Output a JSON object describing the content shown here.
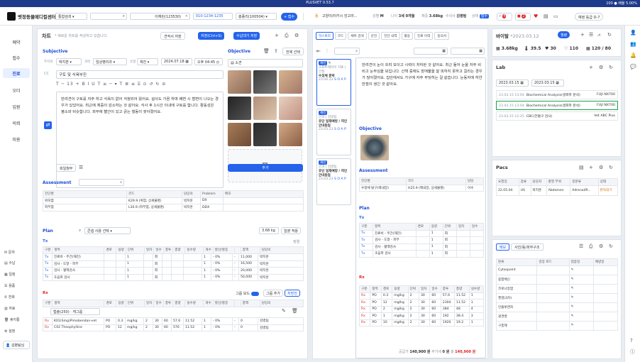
{
  "titlebar": {
    "title": "PLUSVET 0.53.7",
    "right": "100 ● 배율 5.00%"
  },
  "header": {
    "clinic": "벳정동물메디컬센터",
    "search_select": "통합검색",
    "owner_name": "이재린(123530)",
    "phone": "010-1234-1235",
    "patient_select": "총종리(100504)",
    "add_label": "+ 접수",
    "pet_badge": "동",
    "pet_desc": "고양이/터키시 앙고라...",
    "sex_label": "성별",
    "sex": "M",
    "age_label": "나이",
    "age": "3세 0개월",
    "weight_label": "체중",
    "weight": "3.68kg",
    "vet_label": "수의사",
    "vet": "김병팀",
    "status_label": "상태",
    "status": "접수",
    "alert_count": "4",
    "memo_count": "2",
    "reserve": "예정 등급 D-7"
  },
  "sidebar": {
    "items": [
      {
        "label": "예약"
      },
      {
        "label": "접수"
      },
      {
        "label": "진료"
      },
      {
        "label": "오더"
      },
      {
        "label": "입원"
      },
      {
        "label": "의뢰"
      },
      {
        "label": "미용"
      }
    ],
    "active": "진료",
    "bottom": [
      {
        "label": "문자"
      },
      {
        "label": "수납"
      },
      {
        "label": "일정"
      },
      {
        "label": "용품"
      },
      {
        "label": "전화"
      },
      {
        "label": "자료"
      },
      {
        "label": "휴지통"
      },
      {
        "label": "설정"
      }
    ],
    "user": "김병팀님"
  },
  "chart": {
    "title": "차트",
    "subtitle": "* 새로운 차트를 작성하고 있습니다.",
    "btn_temp": "견적서 저장",
    "btn_save": "저장(Ctrl+S)",
    "btn_after": "수납대기 저장",
    "subjective": "Subjective",
    "objective": "Objective",
    "vet_label": "주치의",
    "vet": "박지훈",
    "subject_label": "과목",
    "subject": "임상병리과",
    "type_label": "유형",
    "type": "재진",
    "date": "2024.07.18",
    "time": "오후 04:45",
    "cc_label": "CC",
    "cc": "구토 및 식욕부진",
    "font_size": "13",
    "memo_text": "반려견이 구토를 자주 하고 식욕이 없어 걱정되어 왔어요. 설사도 가끔 하며 배변 시 혈변이 나오는 경우가 있었어요. 최근에 체중이 감소하는 것 같아요. 식사 후 1시간 이내에 구토를 합니다. 활동성은 평소와 비슷합니다. 피부에 빨간이 있고 긁는 행동이 잦아졌어요.",
    "btn_history": "회일청부",
    "select_all": "전체 선택",
    "add_label": "추가",
    "obj_caption": "소견",
    "assessment": "Assessment",
    "assess_headers": [
      "진단명",
      "코드",
      "담당의",
      "Problem",
      "메모"
    ],
    "assess_rows": [
      [
        "위모염",
        "K29.9 (위염, 상세불명)",
        "박지훈",
        "DX",
        ""
      ],
      [
        "피부염",
        "L30.9 (피부염, 상세불명)",
        "박지훈",
        "DDX",
        ""
      ]
    ],
    "plan": "Plan",
    "plan_search": "콘셉 사용 선택",
    "plan_weight": "3.68 kg",
    "plan_apply": "일괄 적용",
    "tx_label": "Tx",
    "tx_tag": "정렬",
    "tx_headers": [
      "구분",
      "항목",
      "경로",
      "용량",
      "단위",
      "일차",
      "일수",
      "총투",
      "총량",
      "실수량",
      "개수",
      "할인/할증",
      "",
      "총액",
      "담당의"
    ],
    "tx_rows": [
      [
        "Tx",
        "진료비 - 주간(재진)",
        "",
        "",
        "1",
        "",
        "회",
        "",
        "",
        "",
        "1",
        "- 0%",
        "-",
        "11,000",
        "박지훈"
      ],
      [
        "Tx",
        "검사 - 도말 - 피부",
        "",
        "",
        "1",
        "",
        "회",
        "",
        "",
        "",
        "1",
        "- 0%",
        "-",
        "16,500",
        "박지훈"
      ],
      [
        "Tx",
        "검사 - 혈액검사",
        "",
        "",
        "1",
        "",
        "회",
        "",
        "",
        "",
        "1",
        "- 0%",
        "-",
        "20,000",
        "박지훈"
      ],
      [
        "Tx",
        "초음파 검사",
        "",
        "",
        "1",
        "",
        "회",
        "",
        "",
        "",
        "1",
        "- 0%",
        "-",
        "50,000",
        "박지훈"
      ]
    ],
    "rx_label": "Rx",
    "rx_group": "그룹 모드",
    "rx_add": "그룹 추가",
    "rx_confirm": "처방전",
    "rx_headers": [
      "구분",
      "항목",
      "경로",
      "용량",
      "단위",
      "일차",
      "일수",
      "총투",
      "총량",
      "실수량",
      "개수",
      "할인/할증",
      "",
      "총액",
      "담당의"
    ],
    "rx_filter": "캡슐(250) · 캐그룹",
    "rx_rows": [
      [
        "Rx",
        "K01(Smg)Pimobendan-vet",
        "PO",
        "0.3",
        "mg/kg",
        "2",
        "30",
        "60",
        "57.6",
        "11.52",
        "1",
        "- 0%",
        "-",
        "0",
        "김병팀"
      ],
      [
        "Rx",
        "C02 Theophylline",
        "PO",
        "12",
        "mg/kg",
        "2",
        "30",
        "60",
        "576",
        "11.52",
        "1",
        "- 0%",
        "-",
        "0",
        "김병팀"
      ]
    ]
  },
  "history": {
    "tabs": [
      "히스토리",
      "코드",
      "체트 검색",
      "문진",
      "진단 내역",
      "활용",
      "진료 이력",
      "동의서"
    ],
    "cards": [
      {
        "tag": "재진",
        "line1": "소프트제어이 치료 | 간질",
        "line2": "수징체 훈박",
        "date": "23.06.23",
        "extra": "S O A P"
      },
      {
        "tag": "재진",
        "line1": "인과 | 김병팀",
        "line2": "유단 일재예방 / 피인 안내동일",
        "date": "23.03.23",
        "extra": "S O A P"
      },
      {
        "tag": "재진",
        "line1": "인과 | 김병팀",
        "line2": "유단 일재예방 / 피인 안내동일",
        "date": "23.03.23",
        "extra": "S O A P"
      }
    ],
    "detail_text": "반려견이 눈이 흐려 보이고 시력이 저하된 것 같아요. 최근 들어 눈을 자주 비비고 눈부심을 보입니다. 산책 중에도 장애물을 잘 피하지 못하고 걸리는 경우가 많아졌어요. 집안에서도 가구에 자주 부딪히는 걸 같습니다. 눈동자에 하얀 반점이 생긴 것 같아요.",
    "objective": "Objective",
    "assessment": "Assessment",
    "assess_headers": [
      "진단명",
      "코드",
      "담당"
    ],
    "assess_row": [
      "수정체 탈구(백내장)",
      "H25.9 (백내장, 상세불명)",
      "이수"
    ],
    "plan": "Plan",
    "tx": "Tx",
    "tx_headers": [
      "구분",
      "항목",
      "경로",
      "용량",
      "단위",
      "일차",
      "일수"
    ],
    "tx_rows": [
      [
        "Tx",
        "진료비 - 주간(재진)",
        "",
        "1",
        "회"
      ],
      [
        "Tx",
        "검사 - 도말 - 피부",
        "",
        "1",
        "회"
      ],
      [
        "Tx",
        "검사 - 혈액검사",
        "",
        "1",
        "회"
      ],
      [
        "Tx",
        "초음파 검사",
        "",
        "1",
        "회"
      ]
    ],
    "rx": "Rx",
    "rx_headers": [
      "구분",
      "항목",
      "경로",
      "용량",
      "단위",
      "일차",
      "일수",
      "총투",
      "총량",
      "실수량"
    ],
    "rx_rows": [
      [
        "Rx",
        "PO",
        "0.3",
        "mg/kg",
        "2",
        "30",
        "60",
        "57.6",
        "11.52",
        "1"
      ],
      [
        "Rx",
        "PO",
        "12",
        "mg/kg",
        "2",
        "30",
        "60",
        "2304",
        "11.52",
        "1"
      ],
      [
        "Rx",
        "PO",
        "2",
        "mg/kg",
        "2",
        "30",
        "60",
        "384",
        "48",
        "4"
      ],
      [
        "Rx",
        "PO",
        "1",
        "mg/kg",
        "2",
        "30",
        "60",
        "192",
        "38.4",
        "3"
      ],
      [
        "Rx",
        "PO",
        "10",
        "mg/kg",
        "2",
        "30",
        "60",
        "1920",
        "19.2",
        "1"
      ]
    ],
    "total_label": "공급가",
    "total": "140,900 원",
    "tax_label": "부가세",
    "tax": "0 원",
    "sum_label": "총",
    "sum": "140,900 원"
  },
  "vitals": {
    "title": "바이탈",
    "date": "*2023.03.12",
    "weight": "3.68kg",
    "temp": "39.5",
    "hr": "30",
    "rr": "110",
    "bp": "120 / 80",
    "btn": "월량"
  },
  "lab": {
    "title": "Lab",
    "date_from": "2023.03.15",
    "date_to": "2023.03.15",
    "rows": [
      [
        "23.03.15 13:04",
        "Biochemical Analysis(생화학 분석)",
        "FUJI NX700"
      ],
      [
        "23.03.15 13:04",
        "Biochemical Analysis(생화학 분석)",
        "FUJI NX700"
      ],
      [
        "23.03.15 12:25",
        "CBC(전혈구 검사)",
        "Vet ABC Plus"
      ]
    ]
  },
  "pacs": {
    "title": "Pacs",
    "headers": [
      "요청일",
      "종류",
      "담당자",
      "촬영 부위",
      "증분류",
      "상태"
    ],
    "row": [
      "22.05.04",
      "US",
      "박지훈",
      "Abdomen",
      "Adrenal/R...",
      "판독대기"
    ]
  },
  "notes": {
    "tabs": [
      "메모",
      "사진/동/피부구조"
    ],
    "headers": [
      "분류",
      "검증 로드",
      "접종일",
      "예방일"
    ],
    "rows": [
      "Cytospoint",
      "종합백신",
      "코로나장염",
      "켄넬(3차)",
      "인플루엔자",
      "광견병",
      "구충제"
    ]
  },
  "right_icons": [
    "person-icon",
    "people-icon",
    "bell-icon",
    "chat-icon",
    "help-icon",
    "info-icon"
  ]
}
